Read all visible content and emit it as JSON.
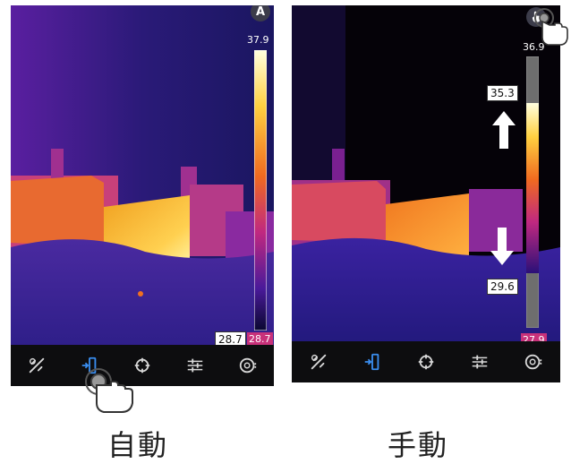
{
  "auto_panel": {
    "mode_badge": "A",
    "scale_max": "37.9",
    "scale_min": "28.7",
    "scale_min_boxed": "28.7",
    "caption": "自動"
  },
  "manual_panel": {
    "scale_max": "36.9",
    "upper_level": "35.3",
    "lower_level": "29.6",
    "scale_min": "27.9",
    "caption": "手動"
  },
  "toolbar_icons": [
    "tools-icon",
    "palette-scale-icon",
    "crosshair-icon",
    "adjust-sliders-icon",
    "gallery-icon"
  ],
  "colors": {
    "toolbar_active": "#3a8ef0",
    "toolbar_icon": "#d8d8d8",
    "min_label_bg": "#c8317a"
  }
}
